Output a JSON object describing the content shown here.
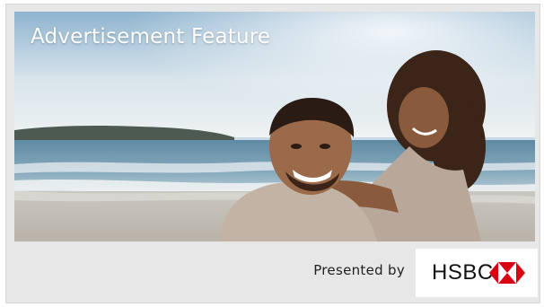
{
  "ad": {
    "feature_label": "Advertisement Feature",
    "presented_by": "Presented by",
    "sponsor": {
      "name": "HSBC",
      "brand_color": "#db0011",
      "icon": "hexagon-logo-icon"
    },
    "image": {
      "description_icon": "couple-on-beach-photo"
    }
  },
  "colors": {
    "card_background": "#e7e7e7",
    "sponsor_box": "#ffffff",
    "label_text": "#ffffff"
  }
}
